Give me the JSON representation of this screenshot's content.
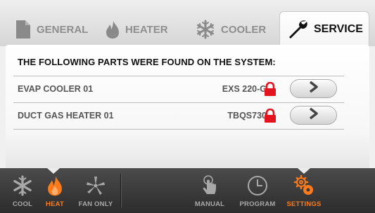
{
  "tabs": {
    "general": "GENERAL",
    "heater": "HEATER",
    "cooler": "COOLER",
    "service": "SERVICE"
  },
  "service_panel": {
    "heading": "THE FOLLOWING PARTS WERE FOUND ON THE SYSTEM:",
    "parts": [
      {
        "name": "EVAP COOLER 01",
        "model": "EXS 220-G",
        "locked": true,
        "icon": "lock-icon"
      },
      {
        "name": "DUCT GAS HEATER 01",
        "model": "TBQS730",
        "locked": true,
        "icon": "lock-icon"
      }
    ]
  },
  "bottom_nav": {
    "cool": "COOL",
    "heat": "HEAT",
    "fan_only": "FAN ONLY",
    "manual": "MANUAL",
    "program": "PROGRAM",
    "settings": "SETTINGS"
  },
  "colors": {
    "accent_orange": "#ff7a1a",
    "lock_red": "#e3141d",
    "dark_bar": "#3a3a3a"
  }
}
